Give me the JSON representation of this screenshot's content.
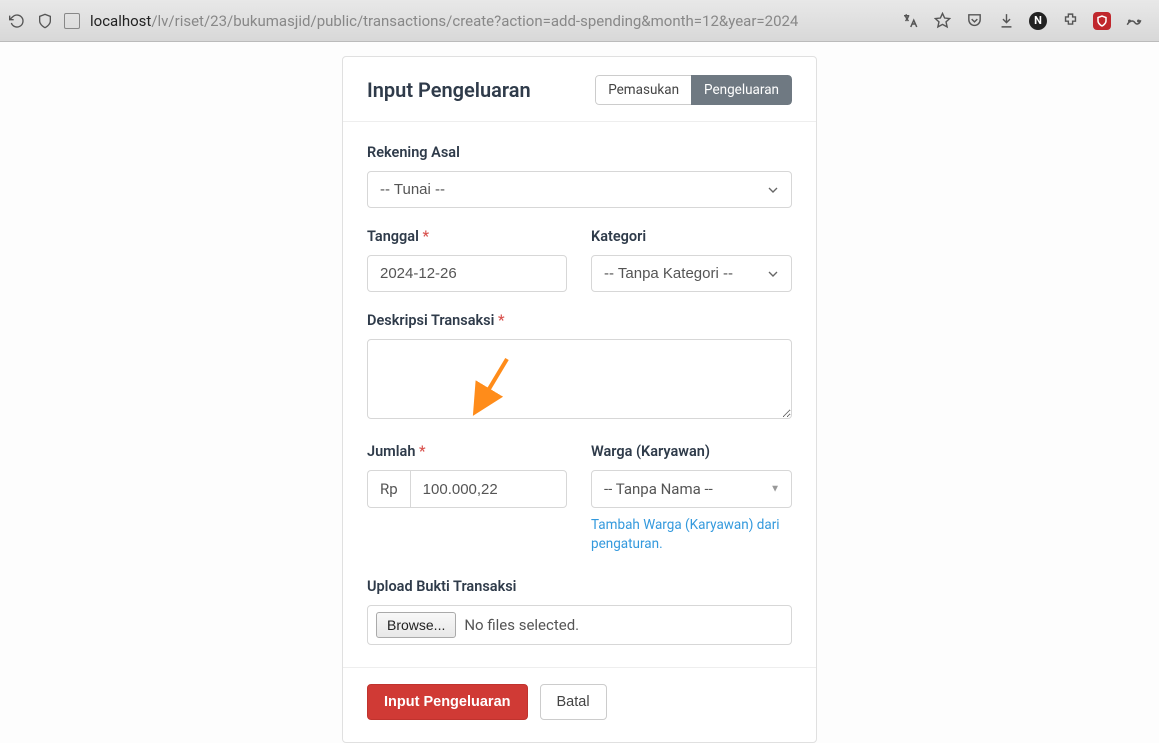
{
  "address_bar": {
    "host": "localhost",
    "path": "/lv/riset/23/bukumasjid/public/transactions/create?action=add-spending&month=12&year=2024"
  },
  "card": {
    "title": "Input Pengeluaran",
    "tab_income": "Pemasukan",
    "tab_spending": "Pengeluaran"
  },
  "form": {
    "account_label": "Rekening Asal",
    "account_value": "-- Tunai --",
    "date_label": "Tanggal",
    "date_value": "2024-12-26",
    "category_label": "Kategori",
    "category_value": "-- Tanpa Kategori --",
    "description_label": "Deskripsi Transaksi",
    "amount_label": "Jumlah",
    "amount_prefix": "Rp",
    "amount_value": "100.000,22",
    "partner_label": "Warga (Karyawan)",
    "partner_value": "-- Tanpa Nama --",
    "partner_help": "Tambah Warga (Karyawan) dari pengaturan.",
    "upload_label": "Upload Bukti Transaksi",
    "browse_label": "Browse...",
    "no_file_label": "No files selected."
  },
  "actions": {
    "submit": "Input Pengeluaran",
    "cancel": "Batal"
  }
}
